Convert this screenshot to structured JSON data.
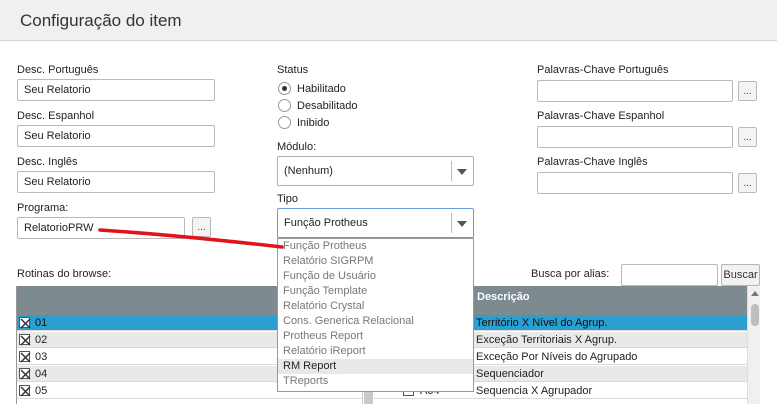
{
  "window": {
    "title": "Configuração do item"
  },
  "left": {
    "desc_pt_label": "Desc. Português",
    "desc_pt_value": "Seu Relatorio",
    "desc_es_label": "Desc. Espanhol",
    "desc_es_value": "Seu Relatorio",
    "desc_en_label": "Desc. Inglês",
    "desc_en_value": "Seu Relatorio",
    "programa_label": "Programa:",
    "programa_value": "RelatorioPRW",
    "ellipsis": "..."
  },
  "middle": {
    "status_label": "Status",
    "status_options": [
      "Habilitado",
      "Desabilitado",
      "Inibido"
    ],
    "status_selected": "Habilitado",
    "modulo_label": "Módulo:",
    "modulo_value": "(Nenhum)",
    "tipo_label": "Tipo",
    "tipo_value": "Função Protheus",
    "tipo_options": [
      "Função Protheus",
      "Relatório SIGRPM",
      "Função de Usuário",
      "Função Template",
      "Relatório Crystal",
      "Cons. Generica Relacional",
      "Protheus Report",
      "Relatório iReport",
      "RM Report",
      "TReports"
    ],
    "tipo_hovered": "RM Report"
  },
  "right": {
    "kw_pt_label": "Palavras-Chave Português",
    "kw_es_label": "Palavras-Chave Espanhol",
    "kw_en_label": "Palavras-Chave Inglês",
    "kw_pt_value": "",
    "kw_es_value": "",
    "kw_en_value": "",
    "ellipsis": "..."
  },
  "browse": {
    "label": "Rotinas do browse:",
    "search_label": "Busca por alias:",
    "search_value": "",
    "search_button": "Buscar",
    "desc_header": "Descrição",
    "left_rows": [
      "01",
      "02",
      "03",
      "04",
      "05"
    ],
    "right_rows": [
      {
        "code": "",
        "desc": "Território X Nível do Agrup."
      },
      {
        "code": "",
        "desc": "Exceção Territoriais X Agrup."
      },
      {
        "code": "",
        "desc": "Exceção Por Níveis do Agrupado"
      },
      {
        "code": "",
        "desc": "Sequenciador"
      },
      {
        "code": "A04",
        "desc": "Sequencia X Agrupador"
      }
    ]
  },
  "colors": {
    "selected_row": "#2a9fd0",
    "grid_header": "#7d8a8f",
    "annotation_line": "#e0141c"
  }
}
